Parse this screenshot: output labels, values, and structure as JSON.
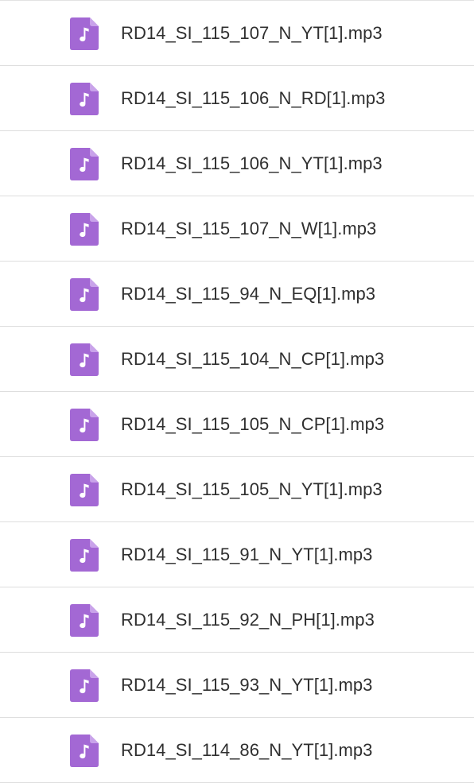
{
  "icon": "music-file-icon",
  "colors": {
    "icon_fill": "#a368d4",
    "icon_fold": "#c9a3ea",
    "icon_note": "#ffffff",
    "text": "#2f2f2f",
    "divider": "#dedede"
  },
  "files": [
    {
      "name": "RD14_SI_115_107_N_YT[1].mp3"
    },
    {
      "name": "RD14_SI_115_106_N_RD[1].mp3"
    },
    {
      "name": "RD14_SI_115_106_N_YT[1].mp3"
    },
    {
      "name": "RD14_SI_115_107_N_W[1].mp3"
    },
    {
      "name": "RD14_SI_115_94_N_EQ[1].mp3"
    },
    {
      "name": "RD14_SI_115_104_N_CP[1].mp3"
    },
    {
      "name": "RD14_SI_115_105_N_CP[1].mp3"
    },
    {
      "name": "RD14_SI_115_105_N_YT[1].mp3"
    },
    {
      "name": "RD14_SI_115_91_N_YT[1].mp3"
    },
    {
      "name": "RD14_SI_115_92_N_PH[1].mp3"
    },
    {
      "name": "RD14_SI_115_93_N_YT[1].mp3"
    },
    {
      "name": "RD14_SI_114_86_N_YT[1].mp3"
    }
  ]
}
